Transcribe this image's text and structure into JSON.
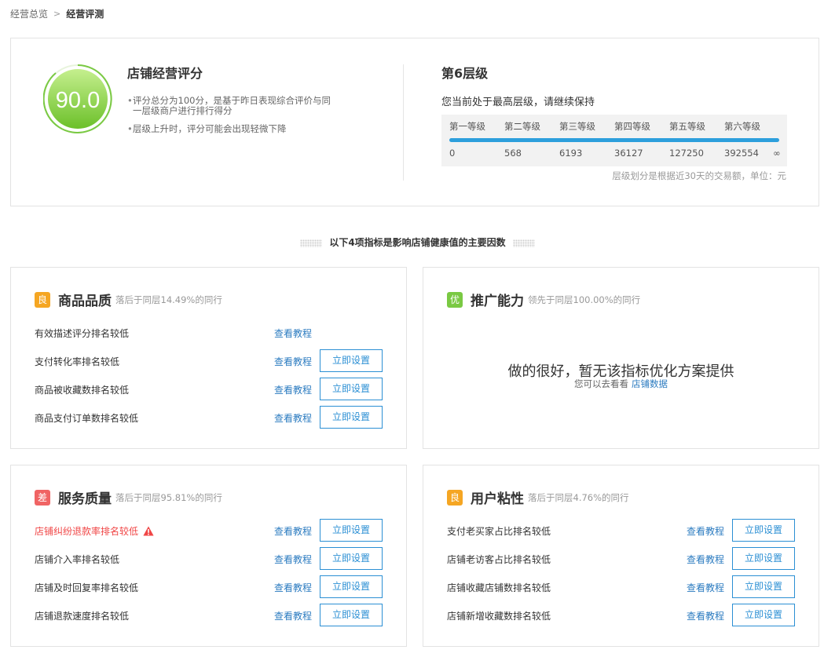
{
  "breadcrumb": {
    "parent": "经营总览",
    "separator": ">",
    "current": "经营评测"
  },
  "score": {
    "value": "90.0",
    "title": "店铺经营评分",
    "bullets": [
      "评分总分为100分，是基于昨日表现综合评价与同一层级商户进行排行得分",
      "层级上升时，评分可能会出现轻微下降"
    ]
  },
  "level": {
    "title": "第6层级",
    "desc": "您当前处于最高层级，请继续保持",
    "labels": [
      "第一等级",
      "第二等级",
      "第三等级",
      "第四等级",
      "第五等级",
      "第六等级"
    ],
    "values": [
      "0",
      "568",
      "6193",
      "36127",
      "127250",
      "392554",
      "∞"
    ],
    "note": "层级划分是根据近30天的交易额，单位：元"
  },
  "section_title": "以下4项指标是影响店铺健康值的主要因数",
  "cards": {
    "quality": {
      "grade": "良",
      "title": "商品品质",
      "sub": "落后于同层14.49%的同行",
      "rows": [
        {
          "label": "有效描述评分排名较低",
          "link": "查看教程",
          "button": ""
        },
        {
          "label": "支付转化率排名较低",
          "link": "查看教程",
          "button": "立即设置"
        },
        {
          "label": "商品被收藏数排名较低",
          "link": "查看教程",
          "button": "立即设置"
        },
        {
          "label": "商品支付订单数排名较低",
          "link": "查看教程",
          "button": "立即设置"
        }
      ]
    },
    "promotion": {
      "grade": "优",
      "title": "推广能力",
      "sub": "领先于同层100.00%的同行",
      "empty_main": "做的很好，暂无该指标优化方案提供",
      "empty_sub": "您可以去看看",
      "empty_link": "店铺数据"
    },
    "service": {
      "grade": "差",
      "title": "服务质量",
      "sub": "落后于同层95.81%的同行",
      "rows": [
        {
          "label": "店铺纠纷退款率排名较低",
          "link": "查看教程",
          "button": "立即设置"
        },
        {
          "label": "店铺介入率排名较低",
          "link": "查看教程",
          "button": "立即设置"
        },
        {
          "label": "店铺及时回复率排名较低",
          "link": "查看教程",
          "button": "立即设置"
        },
        {
          "label": "店铺退款速度排名较低",
          "link": "查看教程",
          "button": "立即设置"
        }
      ]
    },
    "stickiness": {
      "grade": "良",
      "title": "用户粘性",
      "sub": "落后于同层4.76%的同行",
      "rows": [
        {
          "label": "支付老买家占比排名较低",
          "link": "查看教程",
          "button": "立即设置"
        },
        {
          "label": "店铺老访客占比排名较低",
          "link": "查看教程",
          "button": "立即设置"
        },
        {
          "label": "店铺收藏店铺数排名较低",
          "link": "查看教程",
          "button": "立即设置"
        },
        {
          "label": "店铺新增收藏数排名较低",
          "link": "查看教程",
          "button": "立即设置"
        }
      ]
    }
  },
  "colors": {
    "accent_blue": "#2b8fd4",
    "score_green": "#7ac943",
    "grade_good": "#f5a623",
    "grade_excellent": "#7ac943",
    "grade_poor": "#f06464",
    "warning_red": "#f04646"
  }
}
